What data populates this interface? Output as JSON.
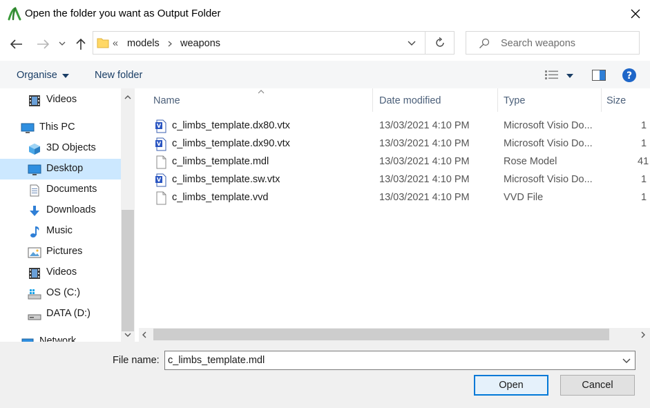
{
  "window": {
    "title": "Open the folder you want as Output Folder",
    "close_icon": "close-icon"
  },
  "nav": {
    "breadcrumb_overflow": "«",
    "crumbs": [
      "models",
      "weapons"
    ],
    "search_placeholder": "Search weapons"
  },
  "toolbar": {
    "organise_label": "Organise",
    "new_folder_label": "New folder"
  },
  "sidebar": {
    "items": [
      {
        "label": "Videos",
        "icon": "videos-icon"
      },
      {
        "label": "This PC",
        "icon": "this-pc-icon"
      },
      {
        "label": "3D Objects",
        "icon": "3d-objects-icon"
      },
      {
        "label": "Desktop",
        "icon": "desktop-icon"
      },
      {
        "label": "Documents",
        "icon": "documents-icon"
      },
      {
        "label": "Downloads",
        "icon": "downloads-icon"
      },
      {
        "label": "Music",
        "icon": "music-icon"
      },
      {
        "label": "Pictures",
        "icon": "pictures-icon"
      },
      {
        "label": "Videos",
        "icon": "videos-icon"
      },
      {
        "label": "OS (C:)",
        "icon": "drive-icon"
      },
      {
        "label": "DATA (D:)",
        "icon": "drive-icon"
      },
      {
        "label": "Network",
        "icon": "network-icon"
      }
    ],
    "selected": "Desktop"
  },
  "files": {
    "columns": [
      "Name",
      "Date modified",
      "Type",
      "Size"
    ],
    "rows": [
      {
        "name": "c_limbs_template.dx80.vtx",
        "date": "13/03/2021 4:10 PM",
        "type": "Microsoft Visio Do...",
        "size": "1",
        "icon": "visio-file-icon"
      },
      {
        "name": "c_limbs_template.dx90.vtx",
        "date": "13/03/2021 4:10 PM",
        "type": "Microsoft Visio Do...",
        "size": "1",
        "icon": "visio-file-icon"
      },
      {
        "name": "c_limbs_template.mdl",
        "date": "13/03/2021 4:10 PM",
        "type": "Rose Model",
        "size": "41",
        "icon": "generic-file-icon"
      },
      {
        "name": "c_limbs_template.sw.vtx",
        "date": "13/03/2021 4:10 PM",
        "type": "Microsoft Visio Do...",
        "size": "1",
        "icon": "visio-file-icon"
      },
      {
        "name": "c_limbs_template.vvd",
        "date": "13/03/2021 4:10 PM",
        "type": "VVD File",
        "size": "1",
        "icon": "generic-file-icon"
      }
    ]
  },
  "footer": {
    "file_name_label": "File name:",
    "file_name_value": "c_limbs_template.mdl",
    "open_label": "Open",
    "cancel_label": "Cancel"
  },
  "colors": {
    "accent": "#0078d7",
    "selection": "#cce8ff",
    "help": "#1e66c8"
  }
}
